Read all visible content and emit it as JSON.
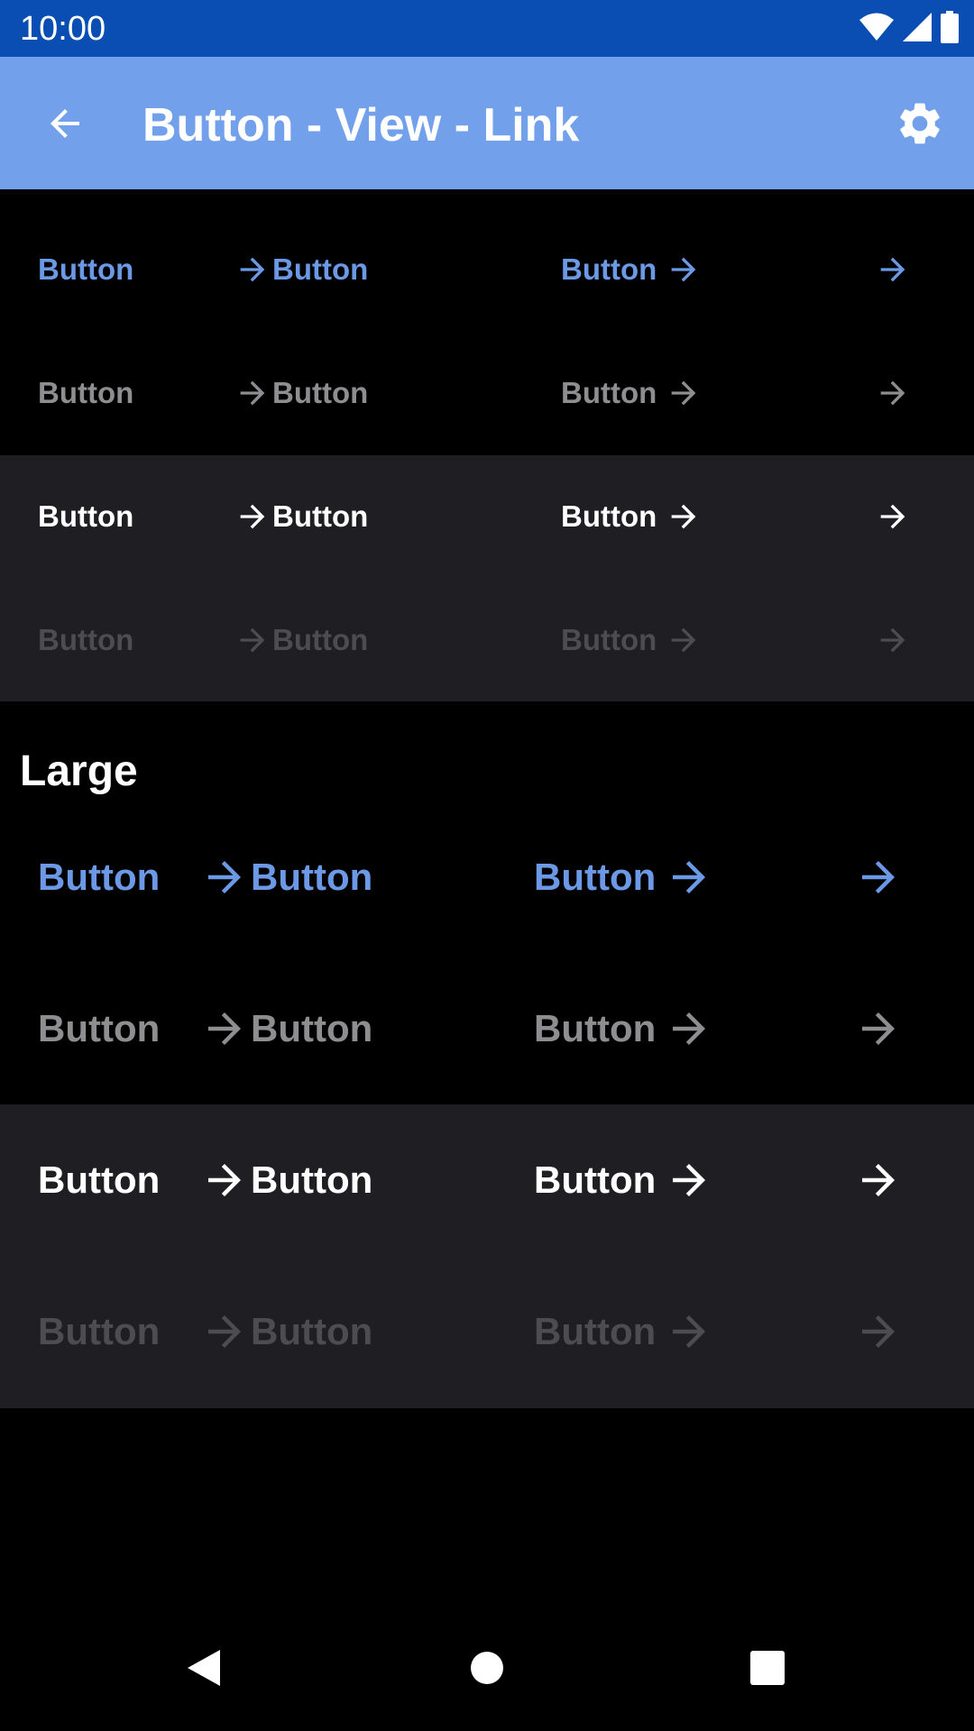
{
  "status_bar": {
    "time": "10:00",
    "icons": [
      "wifi-icon",
      "signal-icon",
      "battery-icon"
    ]
  },
  "app_bar": {
    "title": "Button - View - Link",
    "back_icon": "arrow-back-icon",
    "settings_icon": "gear-icon"
  },
  "colors": {
    "status_bar": "#0a4eb3",
    "app_bar": "#72a0eb",
    "background": "#000000",
    "band": "#1f1e22",
    "accent": "#6b99e6",
    "secondary": "#8e8e91",
    "white": "#ffffff",
    "disabled": "#4d4c50"
  },
  "button_label": "Button",
  "sizes": {
    "large_heading": "Large"
  },
  "nav_bar": {
    "icons": [
      "back-triangle-icon",
      "home-circle-icon",
      "recents-square-icon"
    ]
  }
}
